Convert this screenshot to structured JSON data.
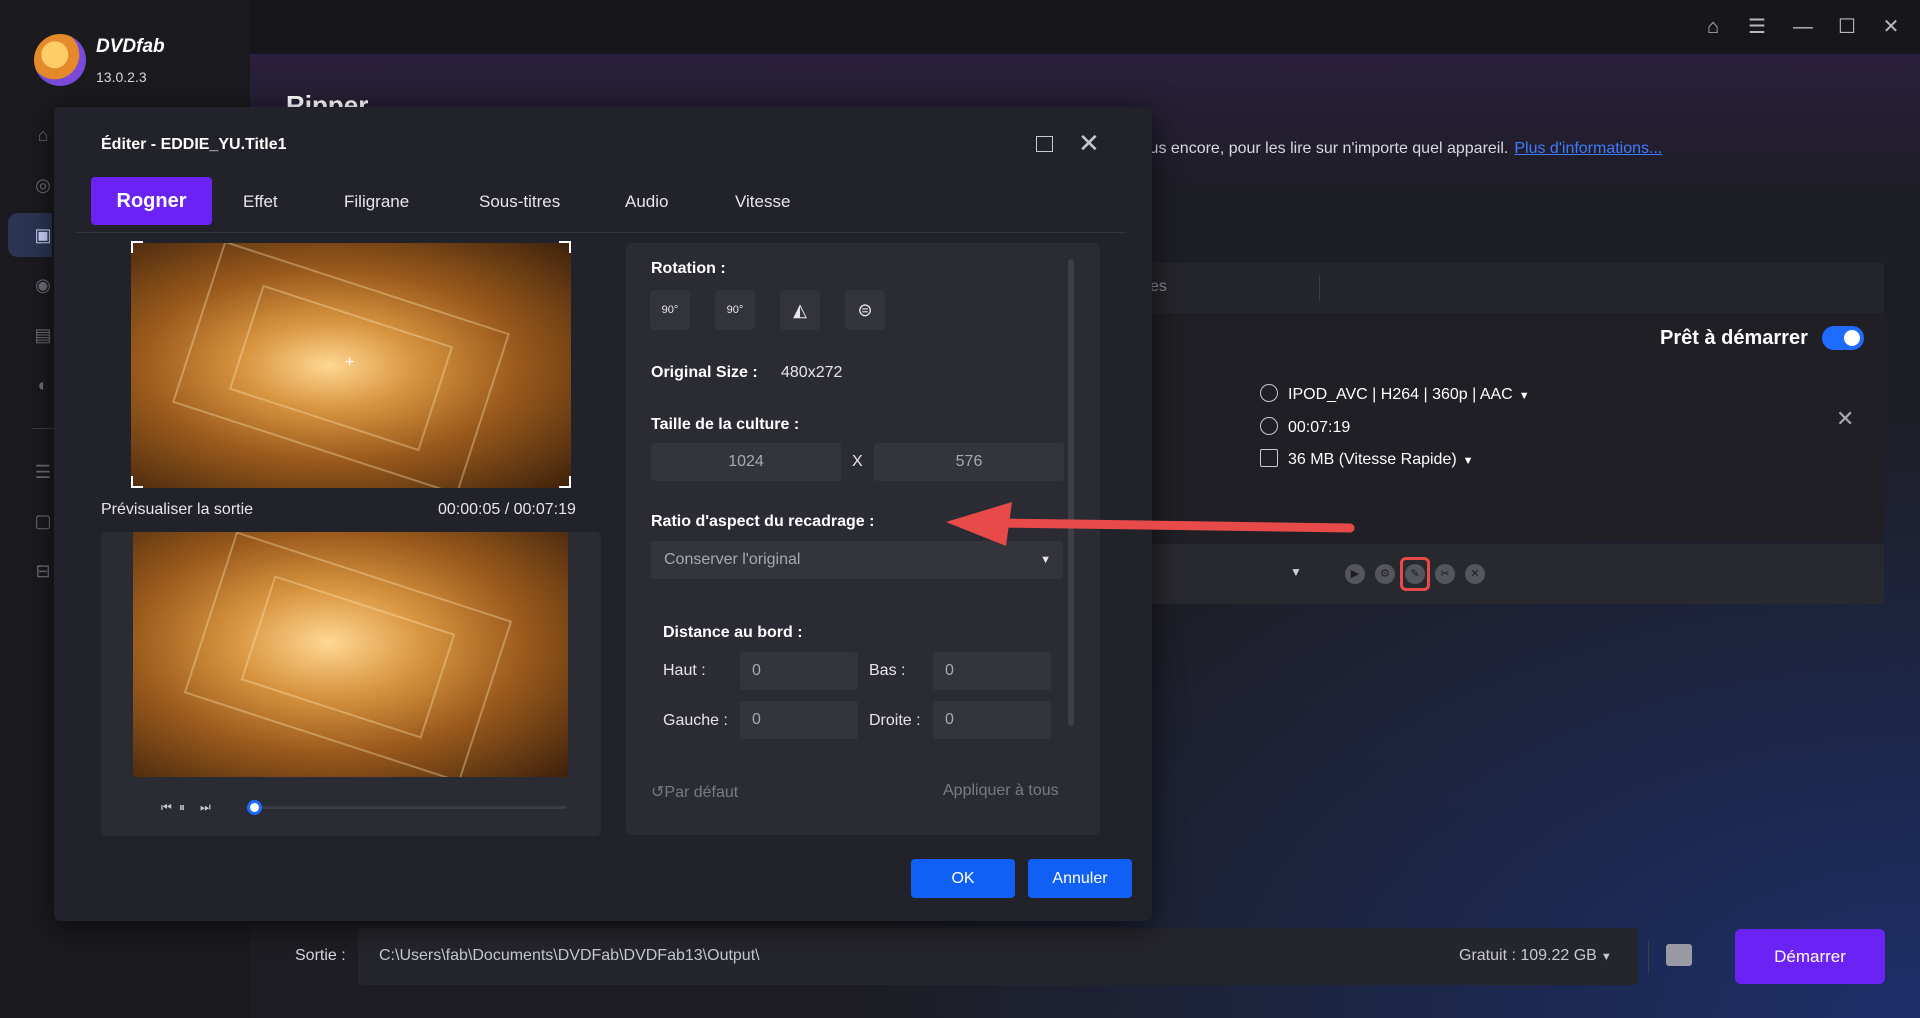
{
  "app": {
    "brand": "DVDfab",
    "version": "13.0.2.3"
  },
  "sidebar": {
    "icons": [
      "home-icon",
      "copy-icon",
      "ripper-icon",
      "creator-icon",
      "video-icon",
      "tools-icon",
      "list-icon",
      "task-icon",
      "archive-icon"
    ]
  },
  "main": {
    "page_title": "Ripper",
    "info_text": "lus encore, pour les lire sur n'importe quel appareil.",
    "info_link": "Plus d'informations...",
    "list_header_tail": "es",
    "ready_label": "Prêt à démarrer",
    "task": {
      "profile": "IPOD_AVC | H264 | 360p | AAC",
      "duration": "00:07:19",
      "size": "36 MB (Vitesse Rapide)"
    }
  },
  "bottom": {
    "output_label": "Sortie :",
    "output_path": "C:\\Users\\fab\\Documents\\DVDFab\\DVDFab13\\Output\\",
    "free_space": "Gratuit : 109.22 GB",
    "start_label": "Démarrer"
  },
  "dialog": {
    "title": "Éditer - EDDIE_YU.Title1",
    "tabs": [
      {
        "label": "Rogner",
        "active": true
      },
      {
        "label": "Effet"
      },
      {
        "label": "Filigrane"
      },
      {
        "label": "Sous-titres"
      },
      {
        "label": "Audio"
      },
      {
        "label": "Vitesse"
      }
    ],
    "preview_label": "Prévisualiser la sortie",
    "preview_time": "00:00:05 / 00:07:19",
    "player_progress": 0.02,
    "rotation_label": "Rotation :",
    "rotation_buttons": [
      "rotate-left-90-icon",
      "rotate-right-90-icon",
      "flip-horizontal-icon",
      "flip-vertical-icon"
    ],
    "rotation_button_text": [
      "90°",
      "90°",
      "◭",
      "⊜"
    ],
    "original_size_label": "Original Size :",
    "original_size_value": "480x272",
    "crop_size_label": "Taille de la culture :",
    "crop_width": "1024",
    "crop_x": "X",
    "crop_height": "576",
    "aspect_label": "Ratio d'aspect du recadrage :",
    "aspect_value": "Conserver l'original",
    "border_label": "Distance au bord :",
    "top_label": "Haut :",
    "top_value": "0",
    "bottom_label": "Bas :",
    "bottom_value": "0",
    "left_label": "Gauche :",
    "left_value": "0",
    "right_label": "Droite :",
    "right_value": "0",
    "default_label": "Par défaut",
    "apply_all_label": "Appliquer à tous",
    "ok_label": "OK",
    "cancel_label": "Annuler"
  },
  "colors": {
    "accent_purple": "#6a22f5",
    "accent_blue": "#1060f5",
    "highlight_red": "#e84a4a"
  }
}
